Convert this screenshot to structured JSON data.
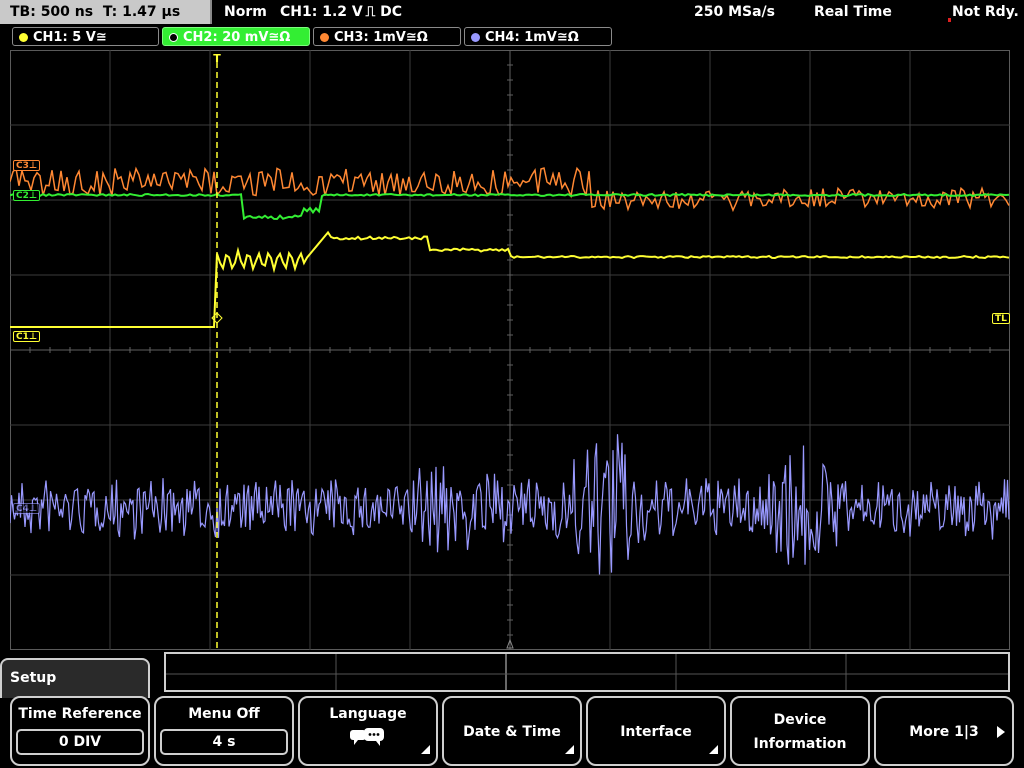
{
  "status": {
    "timebase": "TB: 500 ns",
    "trigger_time": "T: 1.47 µs",
    "trigger_mode": "Norm",
    "trigger_info": "CH1: 1.2 V ⎍ DC",
    "sample_rate": "250 MSa/s",
    "acq_mode": "Real Time",
    "state": "Not Rdy."
  },
  "channels": [
    {
      "label": "CH1: 5 V≅",
      "color": "#ffff33"
    },
    {
      "label": "CH2: 20 mV≅Ω",
      "color": "#33ee33"
    },
    {
      "label": "CH3: 1mV≅Ω",
      "color": "#ff8833"
    },
    {
      "label": "CH4: 1mV≅Ω",
      "color": "#9999ff"
    }
  ],
  "markers": {
    "c3": "C3⊥",
    "c2": "C2⊥",
    "c1": "C1⊥",
    "c4": "C4⊥",
    "tl": "TL",
    "trigger": "T"
  },
  "menu": {
    "title": "Setup",
    "softkeys": [
      {
        "label": "Time Reference",
        "value": "0 DIV"
      },
      {
        "label": "Menu Off",
        "value": "4 s"
      },
      {
        "label": "Language",
        "icon": "speech-bubbles-icon"
      },
      {
        "label": "Date & Time"
      },
      {
        "label": "Interface"
      },
      {
        "label_line1": "Device",
        "label_line2": "Information"
      },
      {
        "label": "More 1|3"
      }
    ]
  },
  "colors": {
    "ch1": "#ffff33",
    "ch2": "#33ee33",
    "ch3": "#ff8833",
    "ch4": "#9999ff",
    "grid": "#4a4a4a",
    "status_bg": "#c9c9c9"
  }
}
